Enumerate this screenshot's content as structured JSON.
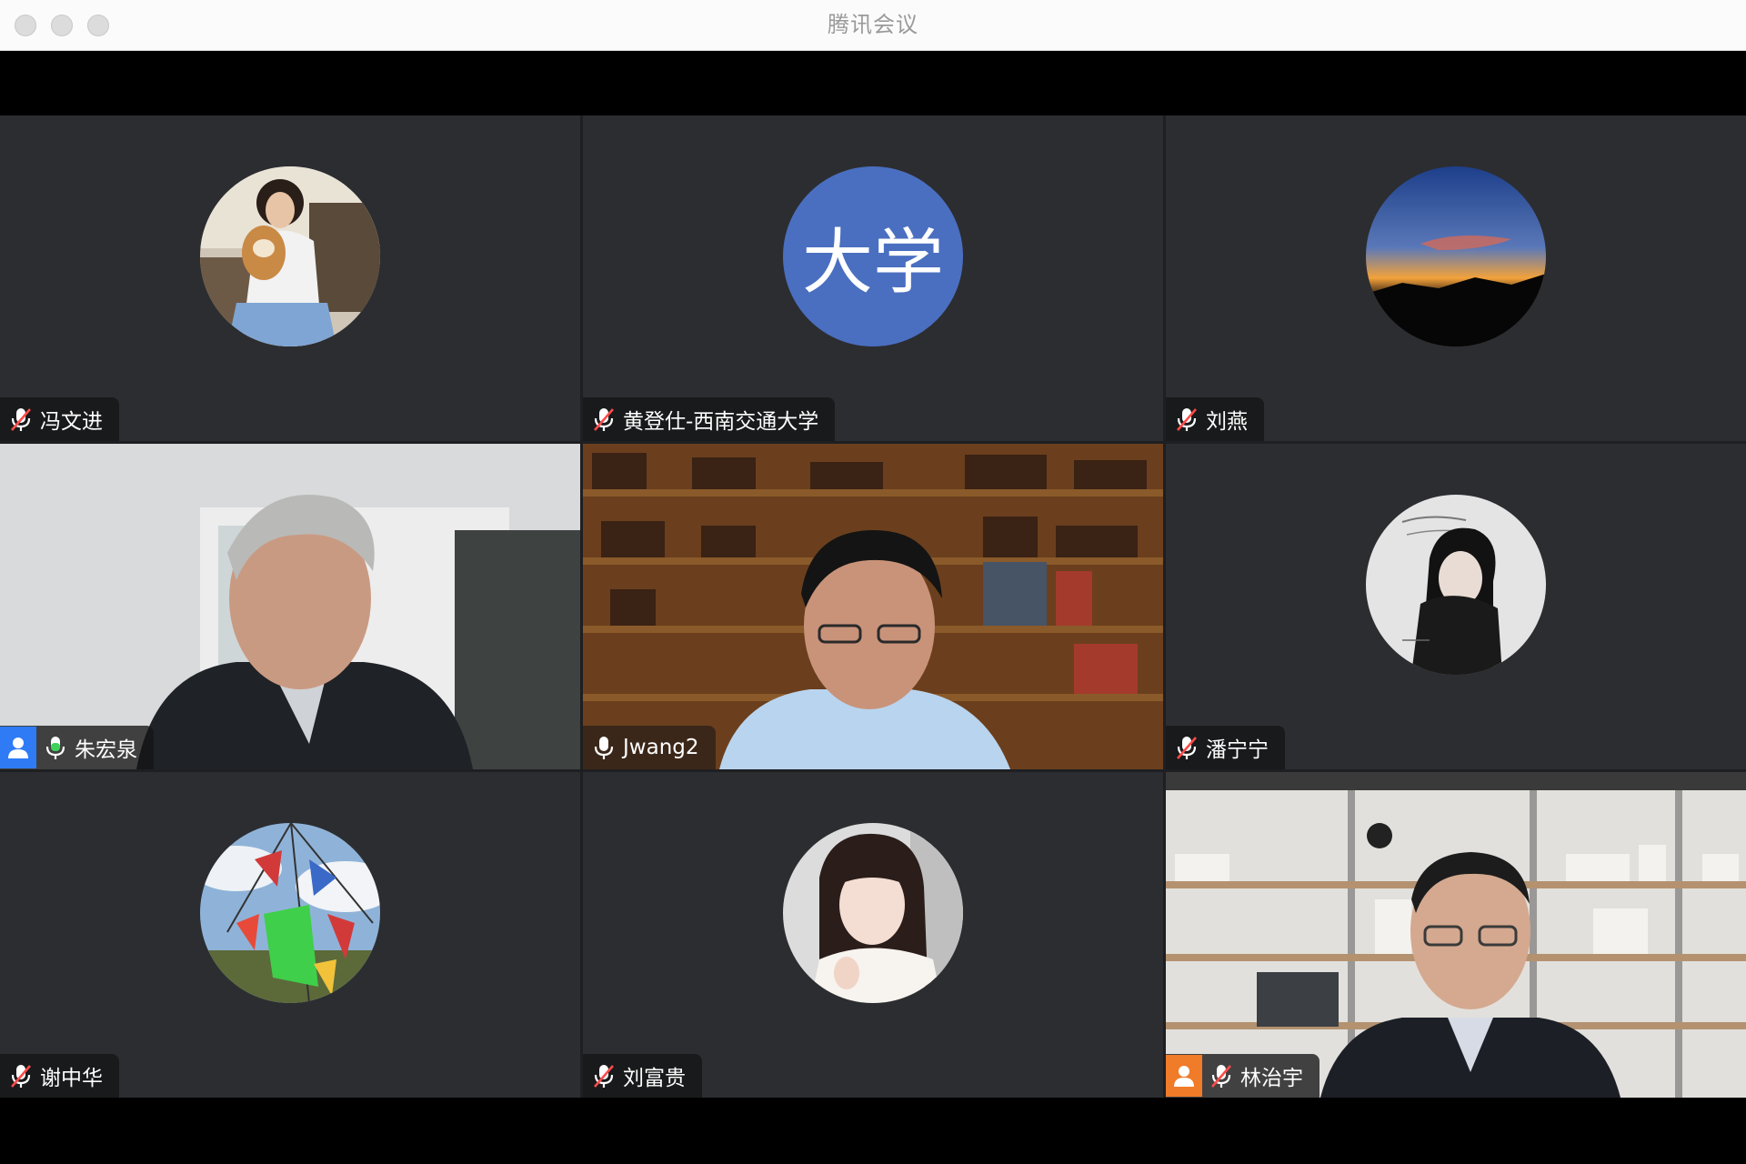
{
  "window": {
    "title": "腾讯会议"
  },
  "participants": [
    {
      "name": "冯文进",
      "mic": "muted",
      "view": "avatar",
      "avatar": "woman-with-dog-photo"
    },
    {
      "name": "黄登仕-西南交通大学",
      "mic": "muted",
      "view": "avatar",
      "avatar_text": "大学",
      "avatar_color": "#4a6fc0"
    },
    {
      "name": "刘燕",
      "mic": "muted",
      "view": "avatar",
      "avatar": "sunset-photo"
    },
    {
      "name": "朱宏泉",
      "mic": "speaking",
      "view": "video",
      "host_badge_color": "#2f7bf6",
      "active_speaker": true
    },
    {
      "name": "Jwang2",
      "mic": "on",
      "view": "video"
    },
    {
      "name": "潘宁宁",
      "mic": "muted",
      "view": "avatar",
      "avatar": "woman-portrait-photo"
    },
    {
      "name": "谢中华",
      "mic": "muted",
      "view": "avatar",
      "avatar": "prayer-flags-photo"
    },
    {
      "name": "刘富贵",
      "mic": "muted",
      "view": "avatar",
      "avatar": "girl-selfie-photo"
    },
    {
      "name": "林治宇",
      "mic": "muted",
      "view": "video",
      "host_badge_color": "#f07b28"
    }
  ],
  "colors": {
    "active_border": "#3fd15a",
    "tile_bg": "#2c2d31",
    "mic_on": "#3fd15a"
  }
}
